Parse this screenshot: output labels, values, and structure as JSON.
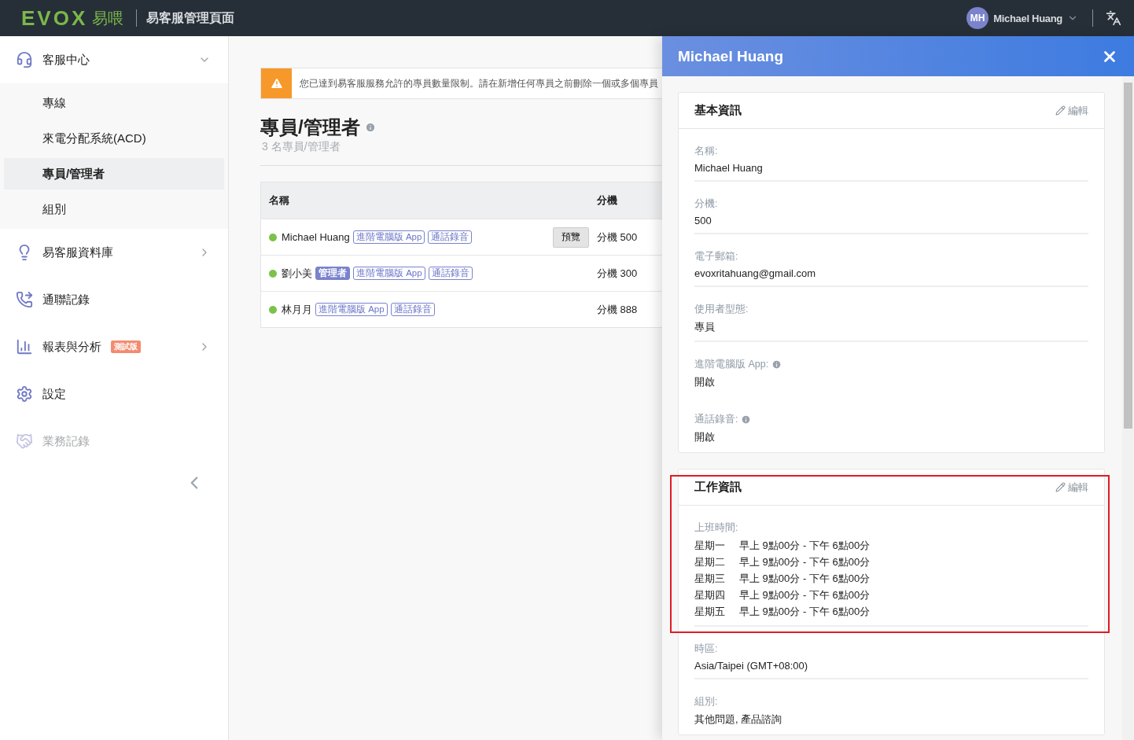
{
  "header": {
    "logo": "EVOX",
    "logo_cjk": "易喂",
    "title": "易客服管理頁面",
    "user": {
      "initials": "MH",
      "name": "Michael Huang"
    }
  },
  "sidebar": {
    "items": [
      {
        "label": "客服中心",
        "expanded": true,
        "children": [
          {
            "label": "專線",
            "selected": false
          },
          {
            "label": "來電分配系統(ACD)",
            "selected": false
          },
          {
            "label": "專員/管理者",
            "selected": true
          },
          {
            "label": "組別",
            "selected": false
          }
        ]
      },
      {
        "label": "易客服資料庫",
        "expanded": false,
        "has_submenu": true,
        "disabled": false
      },
      {
        "label": "通聯記錄",
        "disabled": false
      },
      {
        "label": "報表與分析",
        "badge": "測試版",
        "expanded": false,
        "has_submenu": true,
        "disabled": false
      },
      {
        "label": "設定",
        "disabled": false
      },
      {
        "label": "業務記錄",
        "disabled": true
      }
    ]
  },
  "banner": {
    "text": "您已達到易客服服務允許的專員數量限制。請在新增任何專員之前刪除一個或多個專員"
  },
  "page": {
    "title": "專員/管理者",
    "subtitle": "3 名專員/管理者"
  },
  "table": {
    "columns": [
      "名稱",
      "分機"
    ],
    "rows": [
      {
        "name": "Michael Huang",
        "color": "#7cc24a",
        "tags": [
          {
            "label": "進階電腦版 App",
            "kind": "outline"
          },
          {
            "label": "通話錄音",
            "kind": "outline"
          }
        ],
        "action": "預覽",
        "extension": "分機 500"
      },
      {
        "name": "劉小美",
        "color": "#7cc24a",
        "tags": [
          {
            "label": "管理者",
            "kind": "filled"
          },
          {
            "label": "進階電腦版 App",
            "kind": "outline"
          },
          {
            "label": "通話錄音",
            "kind": "outline"
          }
        ],
        "extension": "分機 300"
      },
      {
        "name": "林月月",
        "color": "#7cc24a",
        "tags": [
          {
            "label": "進階電腦版 App",
            "kind": "outline"
          },
          {
            "label": "通話錄音",
            "kind": "outline"
          }
        ],
        "extension": "分機 888"
      }
    ]
  },
  "panel": {
    "title": "Michael Huang",
    "sections": [
      {
        "title": "基本資訊",
        "edit": "編輯",
        "highlighted": false,
        "fields": [
          {
            "kind": "text",
            "label": "名稱:",
            "value": "Michael Huang",
            "divider": true
          },
          {
            "kind": "text",
            "label": "分機:",
            "value": "500",
            "divider": true
          },
          {
            "kind": "text",
            "label": "電子郵箱:",
            "value": "evoxritahuang@gmail.com",
            "divider": true
          },
          {
            "kind": "text",
            "label": "使用者型態:",
            "value": "專員",
            "divider": true
          },
          {
            "kind": "text",
            "label": "進階電腦版 App:",
            "info": true,
            "value": "開啟",
            "divider": false
          },
          {
            "kind": "text",
            "label": "通話錄音:",
            "info": true,
            "value": "開啟",
            "divider": false
          }
        ]
      },
      {
        "title": "工作資訊",
        "edit": "編輯",
        "highlighted": true,
        "fields": [
          {
            "kind": "schedule",
            "label": "上班時間:",
            "divider": true,
            "rows": [
              {
                "day": "星期一",
                "time": "早上 9點00分 - 下午 6點00分"
              },
              {
                "day": "星期二",
                "time": "早上 9點00分 - 下午 6點00分"
              },
              {
                "day": "星期三",
                "time": "早上 9點00分 - 下午 6點00分"
              },
              {
                "day": "星期四",
                "time": "早上 9點00分 - 下午 6點00分"
              },
              {
                "day": "星期五",
                "time": "早上 9點00分 - 下午 6點00分"
              }
            ]
          },
          {
            "kind": "text",
            "label": "時區:",
            "value": "Asia/Taipei (GMT+08:00)",
            "divider": true
          },
          {
            "kind": "text",
            "label": "組別:",
            "value": "其他問題, 產品諮詢",
            "divider": false
          }
        ]
      }
    ]
  }
}
